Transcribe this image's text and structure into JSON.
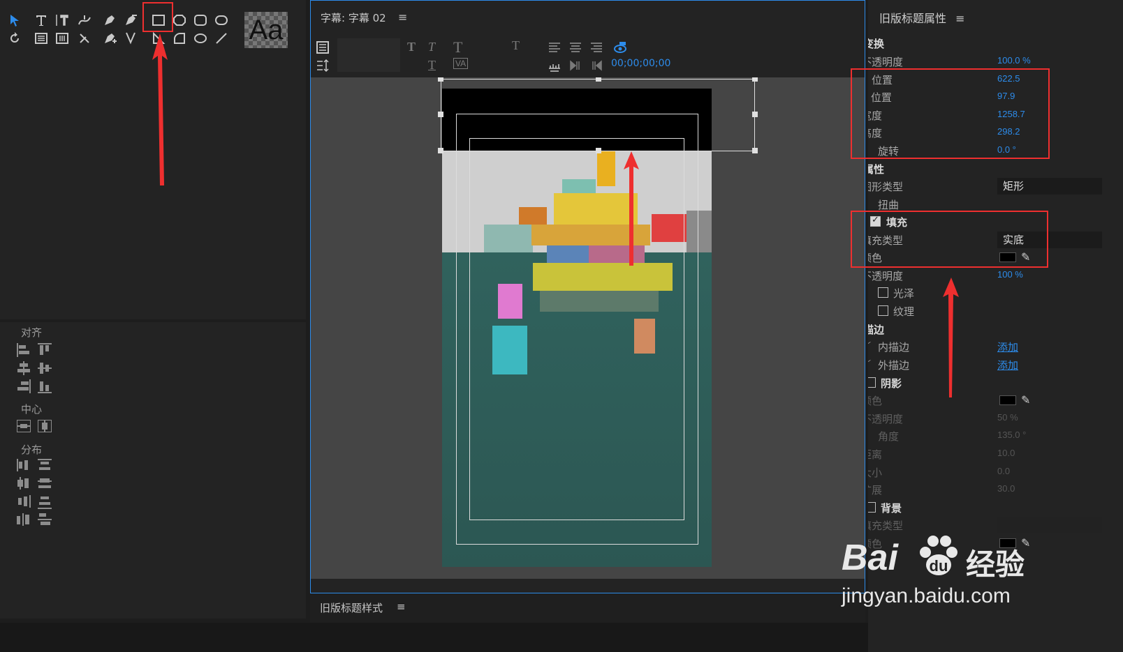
{
  "tools": {
    "text_sample": "Aa"
  },
  "align_panel": {
    "align_label": "对齐",
    "center_label": "中心",
    "distribute_label": "分布"
  },
  "monitor": {
    "title": "字幕: 字幕 02",
    "menu_glyph": "≡",
    "timecode": "00;00;00;00"
  },
  "bottom": {
    "styles_tab": "旧版标题样式",
    "menu_glyph": "≡"
  },
  "properties": {
    "title": "旧版标题属性",
    "menu_glyph": "≡",
    "transform": {
      "header": "变换",
      "opacity_label": "不透明度",
      "opacity_value": "100.0 %",
      "x_label": "X 位置",
      "x_value": "622.5",
      "y_label": "Y 位置",
      "y_value": "97.9",
      "width_label": "宽度",
      "width_value": "1258.7",
      "height_label": "高度",
      "height_value": "298.2",
      "rotation_label": "旋转",
      "rotation_value": "0.0 °"
    },
    "attributes": {
      "header": "属性",
      "shape_type_label": "图形类型",
      "shape_type_value": "矩形",
      "distort_label": "扭曲"
    },
    "fill": {
      "header": "填充",
      "fill_type_label": "填充类型",
      "fill_type_value": "实底",
      "color_label": "颜色",
      "color_value": "#000000",
      "opacity_label": "不透明度",
      "opacity_value": "100 %",
      "sheen_label": "光泽",
      "texture_label": "纹理"
    },
    "stroke": {
      "header": "描边",
      "inner_label": "内描边",
      "inner_action": "添加",
      "outer_label": "外描边",
      "outer_action": "添加"
    },
    "shadow": {
      "header": "阴影",
      "color_label": "颜色",
      "opacity_label": "不透明度",
      "opacity_value": "50 %",
      "angle_label": "角度",
      "angle_value": "135.0 °",
      "distance_label": "距离",
      "distance_value": "10.0",
      "size_label": "大小",
      "size_value": "0.0",
      "spread_label": "扩展",
      "spread_value": "30.0"
    },
    "background": {
      "header": "背景",
      "fill_type_label": "填充类型",
      "color_label": "颜色"
    }
  },
  "watermark": {
    "brand": "Bai",
    "brand_suffix": "经验",
    "url": "jingyan.baidu.com"
  },
  "colors": {
    "accent": "#2d8ceb",
    "annotation": "#ee2f2f"
  }
}
